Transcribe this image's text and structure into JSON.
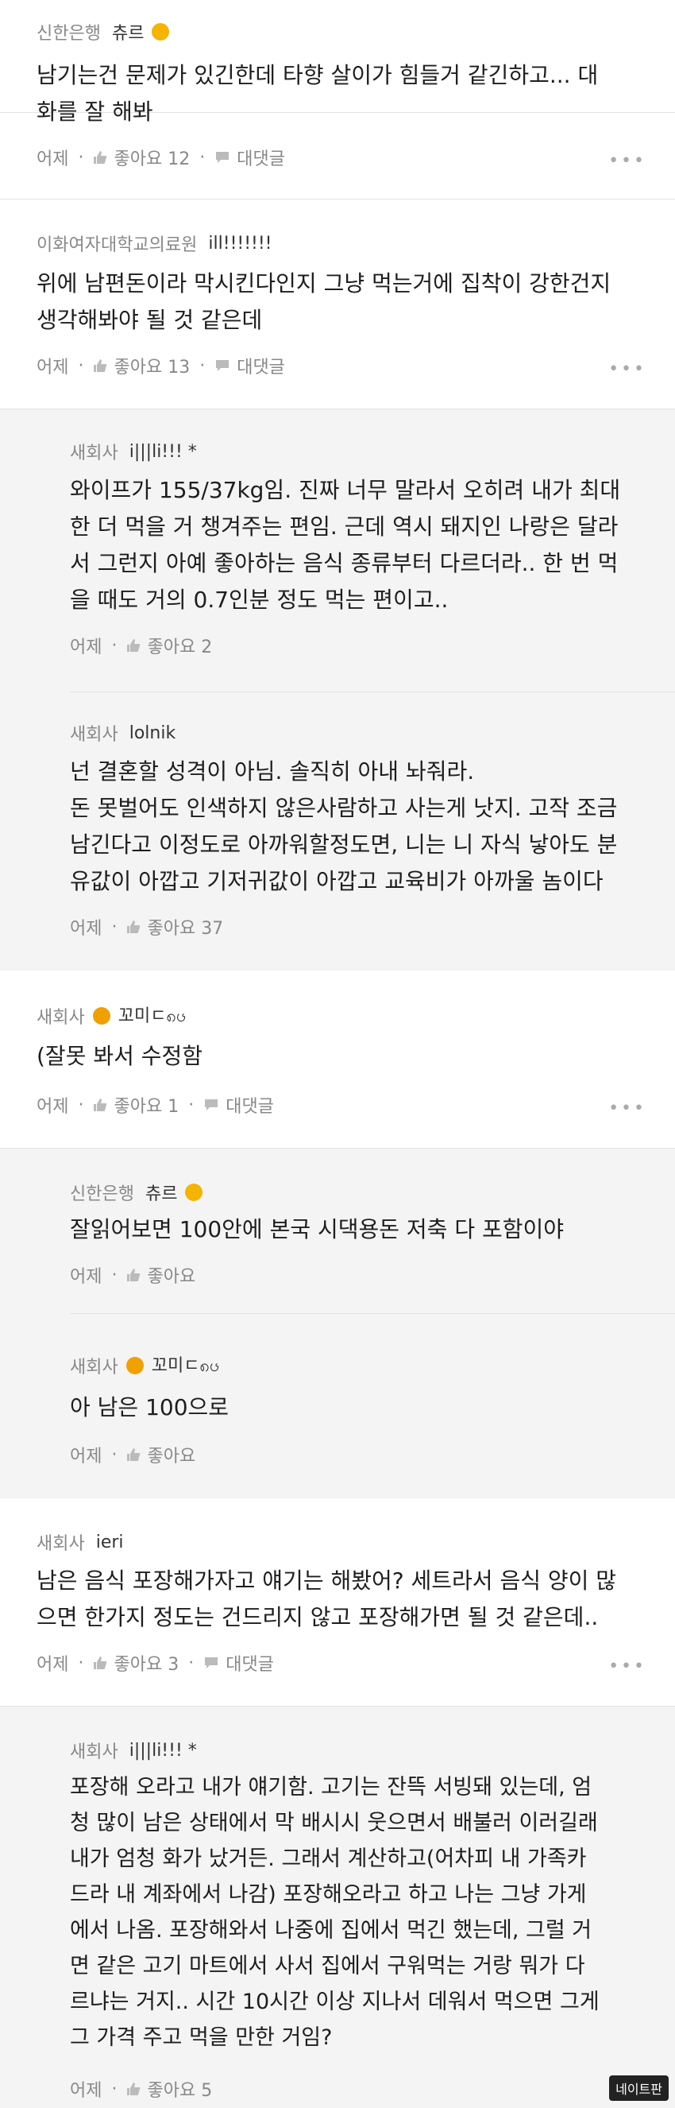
{
  "comments": [
    {
      "org": "신한은행",
      "nick": "츄르",
      "text": "남기는건 문제가 있긴한데 타향 살이가 힘들거 같긴하고... 대\n화를 잘 해봐",
      "time": "어제",
      "like": "좋아요 12",
      "reply": "대댓글",
      "more": "•••"
    },
    {
      "org": "이화여자대학교의료원",
      "nick": "ill!!!!!!!",
      "text": "위에 남편돈이라 막시킨다인지 그냥 먹는거에 집착이 강한건지\n생각해봐야 될 것 같은데",
      "time": "어제",
      "like": "좋아요 13",
      "reply": "대댓글",
      "more": "•••"
    },
    {
      "org": "새회사",
      "nick": "i|||li!!! *",
      "text": "와이프가 155/37kg임. 진짜 너무 말라서 오히려 내가 최대\n한 더 먹을 거 챙겨주는 편임. 근데 역시 돼지인 나랑은 달라\n서 그런지 아예 좋아하는 음식 종류부터 다르더라.. 한 번 먹\n을 때도 거의 0.7인분 정도 먹는 편이고..",
      "time": "어제",
      "like": "좋아요 2"
    },
    {
      "org": "새회사",
      "nick": "lolnik",
      "text": "넌 결혼할 성격이 아님. 솔직히 아내 놔줘라.\n돈 못벌어도 인색하지 않은사람하고 사는게 낫지. 고작 조금\n남긴다고 이정도로 아까워할정도면, 니는 니 자식 낳아도 분\n유값이 아깝고 기저귀값이 아깝고 교육비가 아까울 놈이다",
      "time": "어제",
      "like": "좋아요 37"
    },
    {
      "org": "새회사",
      "nick": "꼬미ㄷ၈ၒ",
      "text": "(잘못 봐서 수정함",
      "time": "어제",
      "like": "좋아요 1",
      "reply": "대댓글",
      "more": "•••"
    },
    {
      "org": "신한은행",
      "nick": "츄르",
      "text": "잘읽어보면 100안에 본국 시댁용돈 저축 다 포함이야",
      "time": "어제",
      "like": "좋아요"
    },
    {
      "org": "새회사",
      "nick": "꼬미ㄷ၈ၒ",
      "text": "아 남은 100으로",
      "time": "어제",
      "like": "좋아요"
    },
    {
      "org": "새회사",
      "nick": "ieri",
      "text": "남은 음식 포장해가자고 얘기는 해봤어? 세트라서 음식 양이 많\n으면 한가지 정도는 건드리지 않고 포장해가면 될 것 같은데..",
      "time": "어제",
      "like": "좋아요 3",
      "reply": "대댓글",
      "more": "•••"
    },
    {
      "org": "새회사",
      "nick": "i|||li!!! *",
      "text": "포장해 오라고 내가 얘기함. 고기는 잔뜩 서빙돼 있는데, 엄\n청 많이 남은 상태에서 막 배시시 웃으면서 배불러 이러길래\n내가 엄청 화가 났거든. 그래서 계산하고(어차피 내 가족카\n드라 내 계좌에서 나감) 포장해오라고 하고 나는 그냥 가게\n에서 나옴. 포장해와서 나중에 집에서 먹긴 했는데, 그럴 거\n면 같은 고기 마트에서 사서 집에서 구워먹는 거랑 뭐가 다\n르냐는 거지.. 시간 10시간 이상 지나서 데워서 먹으면 그게\n그 가격 주고 먹을 만한 거임?",
      "time": "어제",
      "like": "좋아요 5"
    }
  ],
  "watermark": "네이트판"
}
